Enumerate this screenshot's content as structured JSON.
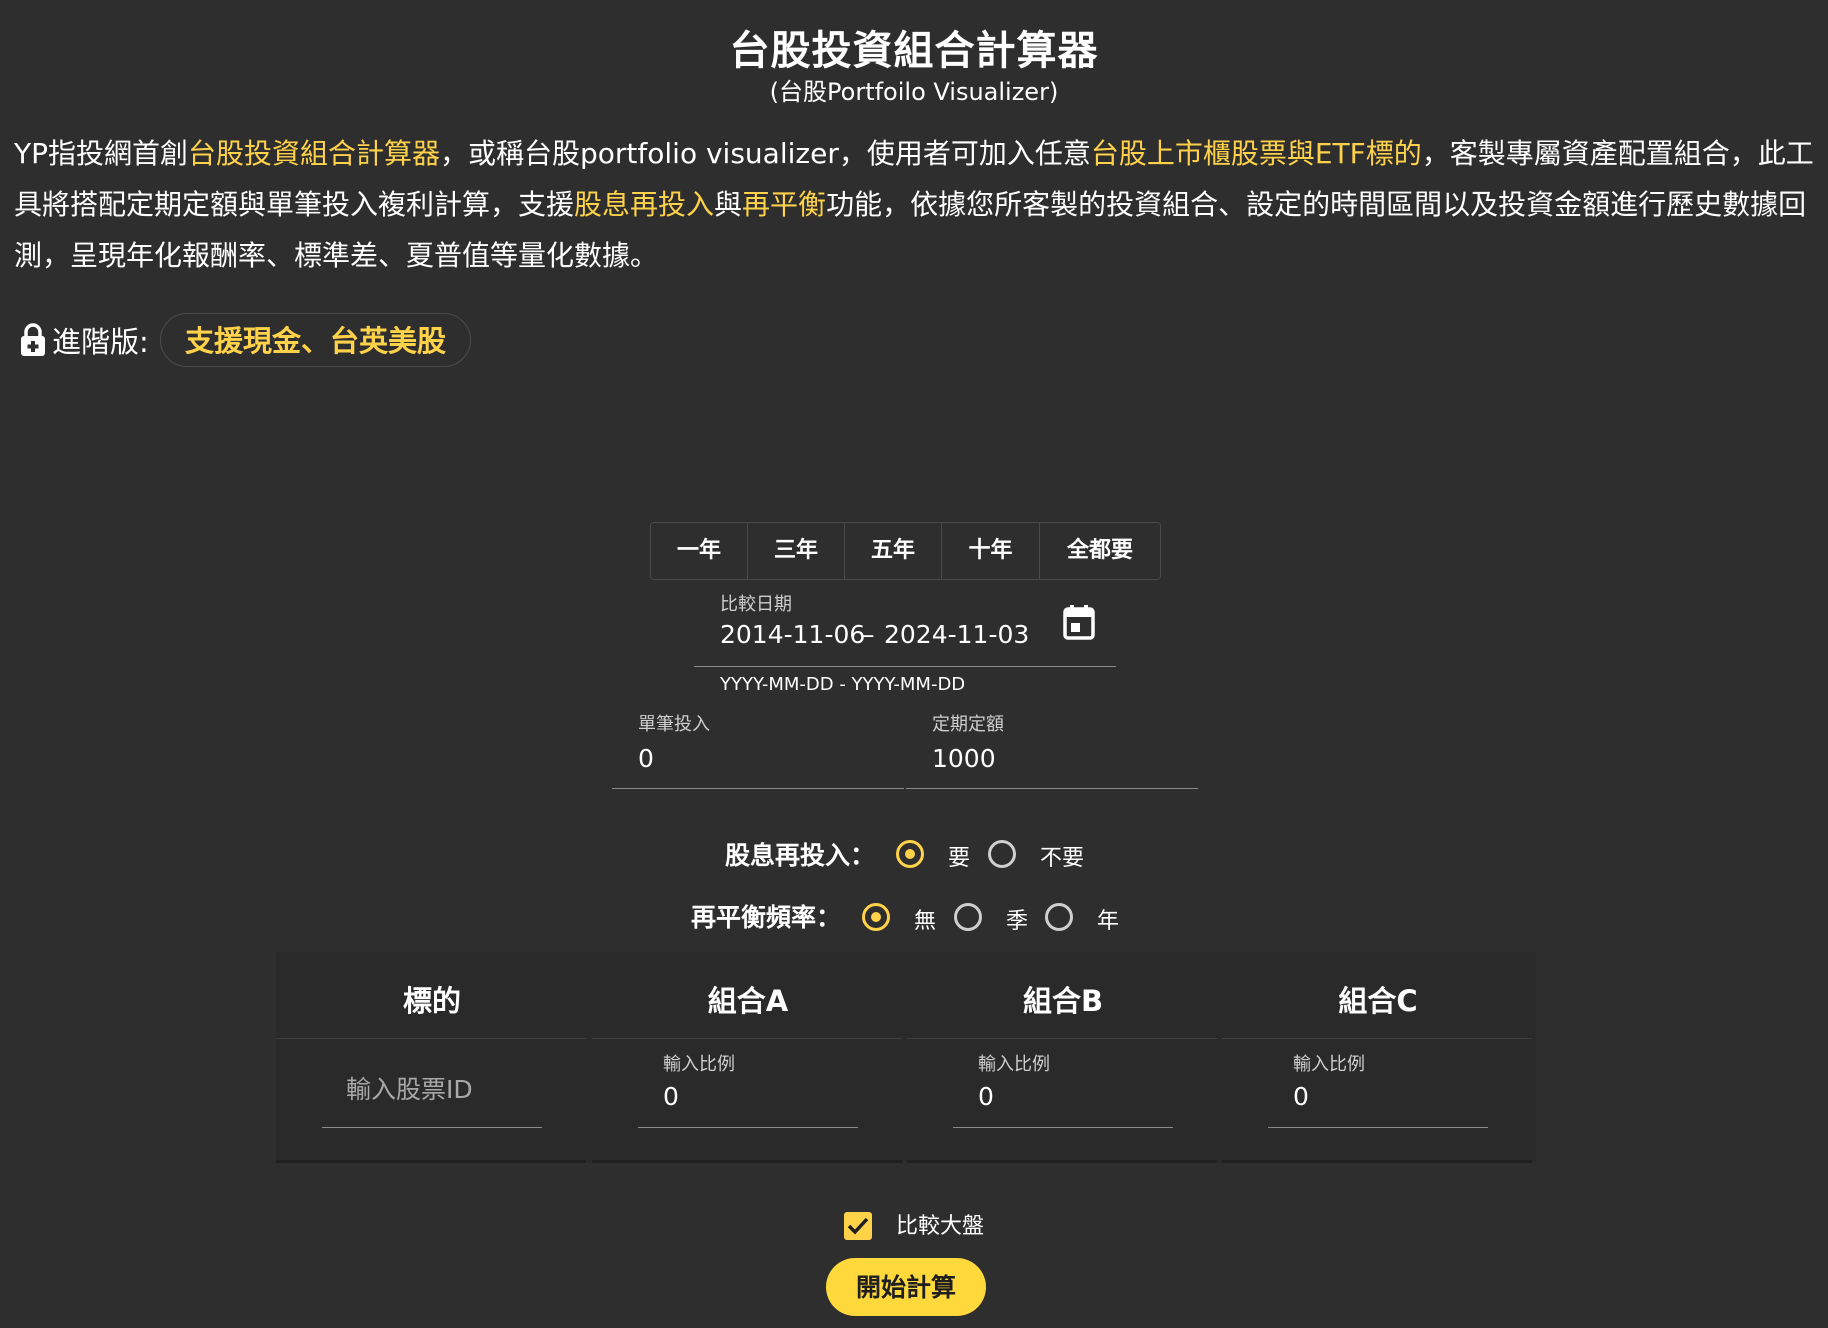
{
  "header": {
    "title": "台股投資組合計算器",
    "subtitle": "(台股Portfoilo Visualizer)"
  },
  "intro": {
    "p1": "YP指投網首創",
    "h1": "台股投資組合計算器",
    "p2": "，或稱台股portfolio visualizer，使用者可加入任意",
    "h2": "台股上市櫃股票與ETF標的",
    "p3": "，客製專屬資產配置組合，此工具將搭配定期定額與單筆投入複利計算，支援",
    "h3": "股息再投入",
    "p4": "與",
    "h4": "再平衡",
    "p5": "功能，依據您所客製的投資組合、設定的時間區間以及投資金額進行歷史數據回測，呈現年化報酬率、標準差、夏普值等量化數據。"
  },
  "advanced": {
    "label": "進階版:",
    "chip": "支援現金、台英美股",
    "icon": "lock-icon"
  },
  "periods": [
    "一年",
    "三年",
    "五年",
    "十年",
    "全都要"
  ],
  "date_range": {
    "label": "比較日期",
    "start": "2014-11-06",
    "separator": "–",
    "end": "2024-11-03",
    "helper": "YYYY-MM-DD - YYYY-MM-DD",
    "icon": "calendar-icon"
  },
  "investment": {
    "lump_sum_label": "單筆投入",
    "lump_sum_value": "0",
    "periodic_label": "定期定額",
    "periodic_value": "1000"
  },
  "dividend": {
    "title": "股息再投入：",
    "options": [
      "要",
      "不要"
    ],
    "selected": "要"
  },
  "rebalance": {
    "title": "再平衡頻率：",
    "options": [
      "無",
      "季",
      "年"
    ],
    "selected": "無"
  },
  "table": {
    "headers": [
      "標的",
      "組合A",
      "組合B",
      "組合C"
    ],
    "stock_placeholder": "輸入股票ID",
    "ratio_label": "輸入比例",
    "ratios": [
      "0",
      "0",
      "0"
    ]
  },
  "compare": {
    "label": "比較大盤",
    "checked": true
  },
  "start_button": "開始計算",
  "colors": {
    "background": "#2e2e2e",
    "accent": "#ffd24a",
    "button": "#ffd93b"
  }
}
